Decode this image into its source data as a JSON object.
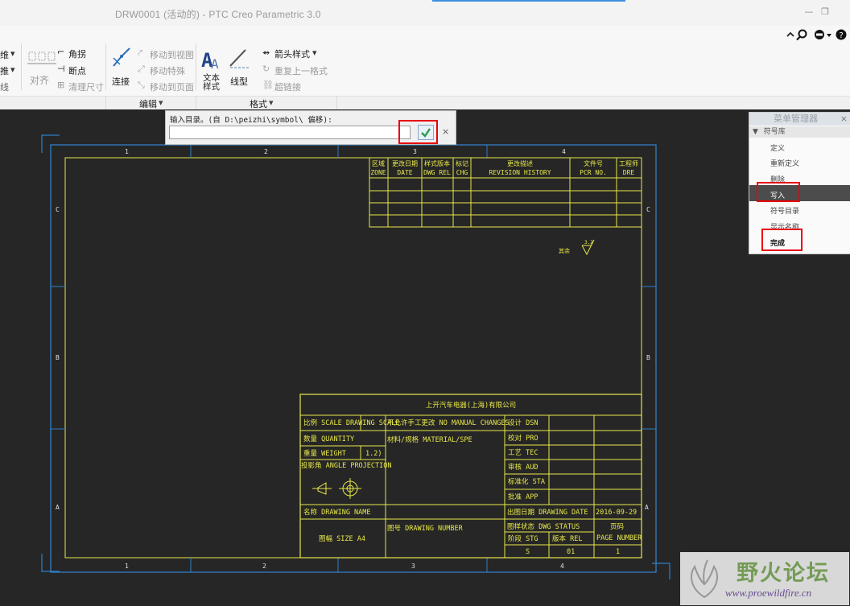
{
  "window": {
    "title": "DRW0001 (活动的) - PTC Creo Parametric 3.0",
    "minimize_glyph": "—",
    "restore_glyph": "❐"
  },
  "ribbon": {
    "left_edge": [
      "维",
      "推",
      "线"
    ],
    "group_align": {
      "label": "对齐",
      "items": [
        "角拐",
        "断点",
        "清理尺寸"
      ]
    },
    "group_edit": {
      "connect_label": "连接",
      "items": [
        "移动到视图",
        "移动特殊",
        "移动到页面"
      ],
      "label": "编辑"
    },
    "group_format": {
      "text_style_label": "文本样式",
      "line_style_label": "线型",
      "items": [
        "箭头样式",
        "重复上一格式",
        "超链接"
      ],
      "label": "格式"
    },
    "icons": [
      "help-icon",
      "search-icon",
      "globe-icon"
    ]
  },
  "dialog": {
    "prompt": "输入目录。(自 D:\\peizhi\\symbol\\ 偏移):",
    "input_value": "",
    "cancel_glyph": "×"
  },
  "menu_manager": {
    "title": "菜单管理器",
    "close_glyph": "×",
    "section": "符号库",
    "items": [
      "定义",
      "重新定义",
      "删除",
      "写入",
      "符号目录",
      "显示名称",
      "完成"
    ],
    "selected": "写入"
  },
  "drawing": {
    "zone_cols": [
      "1",
      "2",
      "3",
      "4"
    ],
    "zone_rows": [
      "C",
      "B",
      "A"
    ],
    "revision_table": {
      "headers": [
        [
          "区域",
          "ZONE"
        ],
        [
          "更改日期",
          "DATE"
        ],
        [
          "样式版本",
          "DWG REL"
        ],
        [
          "标记",
          "CHG"
        ],
        [
          "更改描述",
          "REVISION HISTORY"
        ],
        [
          "文件号",
          "PCR NO."
        ],
        [
          "工程师",
          "DRE"
        ]
      ]
    },
    "surface_symbol_label": "其余",
    "title_block": {
      "company": "上开汽车电器(上海)有限公司",
      "scale": "比例 SCALE DRAWING SCALE",
      "no_change": "不允许手工更改 NO MANUAL CHANGES",
      "design": "设计  DSN",
      "quantity": "数量 QUANTITY",
      "material": "材料/规格 MATERIAL/SPE",
      "proof": "校对  PRO",
      "weight": "重量 WEIGHT",
      "weight_value": "1.2)",
      "process": "工艺  TEC",
      "projection": "投影角 ANGLE PROJECTION",
      "review": "审核  AUD",
      "standard": "标准化 STA",
      "approve": "批准  APP",
      "name": "名称 DRAWING NAME",
      "issue_date": "出图日期 DRAWING DATE",
      "issue_date_value": "2016-09-29",
      "drawing_number": "图号 DRAWING NUMBER",
      "status": "图样状态  DWG STATUS",
      "page": "页码",
      "page_number": "PAGE NUMBER",
      "size": "图幅 SIZE  A4",
      "stage": "阶段  STG",
      "rev": "版本  REL",
      "stage_value": "S",
      "rev_value": "01",
      "page_value": "1"
    }
  },
  "watermark": {
    "name": "野火论坛",
    "url": "www.proewildfire.cn"
  },
  "colors": {
    "frame_blue": "#2f7fc8",
    "drawing_yellow": "#e8e84a",
    "highlight_red": "#e8000a"
  }
}
